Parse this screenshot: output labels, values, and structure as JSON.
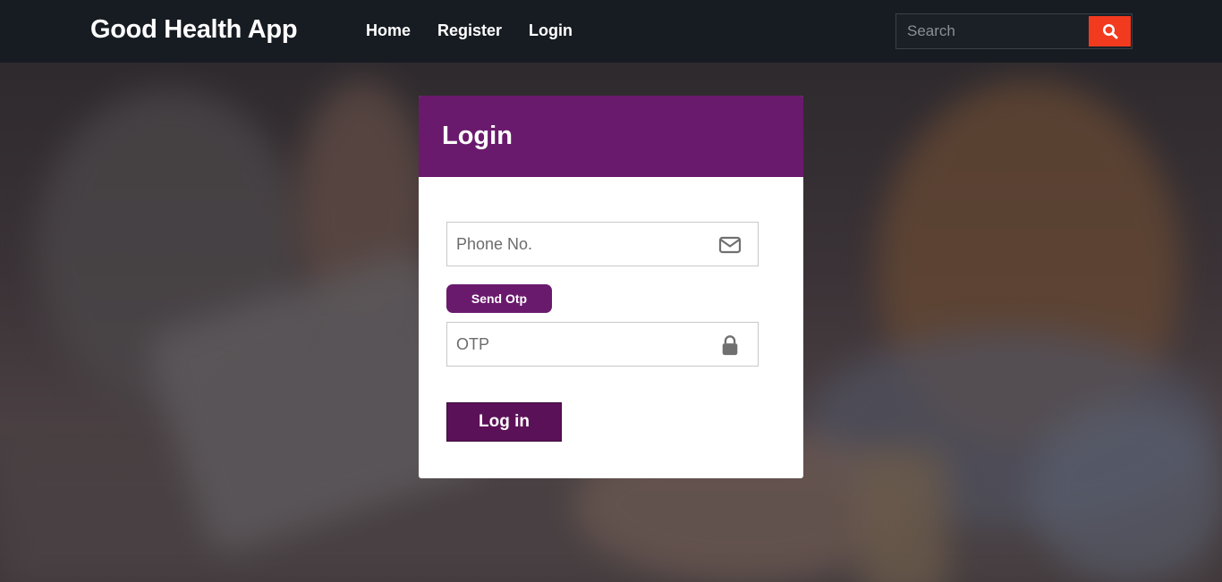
{
  "navbar": {
    "brand": "Good Health App",
    "links": [
      {
        "label": "Home"
      },
      {
        "label": "Register"
      },
      {
        "label": "Login"
      }
    ],
    "search": {
      "placeholder": "Search",
      "button_icon": "search-icon"
    }
  },
  "login_card": {
    "title": "Login",
    "phone_field": {
      "placeholder": "Phone No.",
      "value": "",
      "icon": "envelope-icon"
    },
    "send_otp_label": "Send Otp",
    "otp_field": {
      "placeholder": "OTP",
      "value": "",
      "icon": "lock-icon"
    },
    "submit_label": "Log in"
  },
  "colors": {
    "navbar_bg": "#171c22",
    "card_header": "#6a1a6d",
    "login_button": "#5b1157",
    "search_button": "#f23a1f"
  }
}
